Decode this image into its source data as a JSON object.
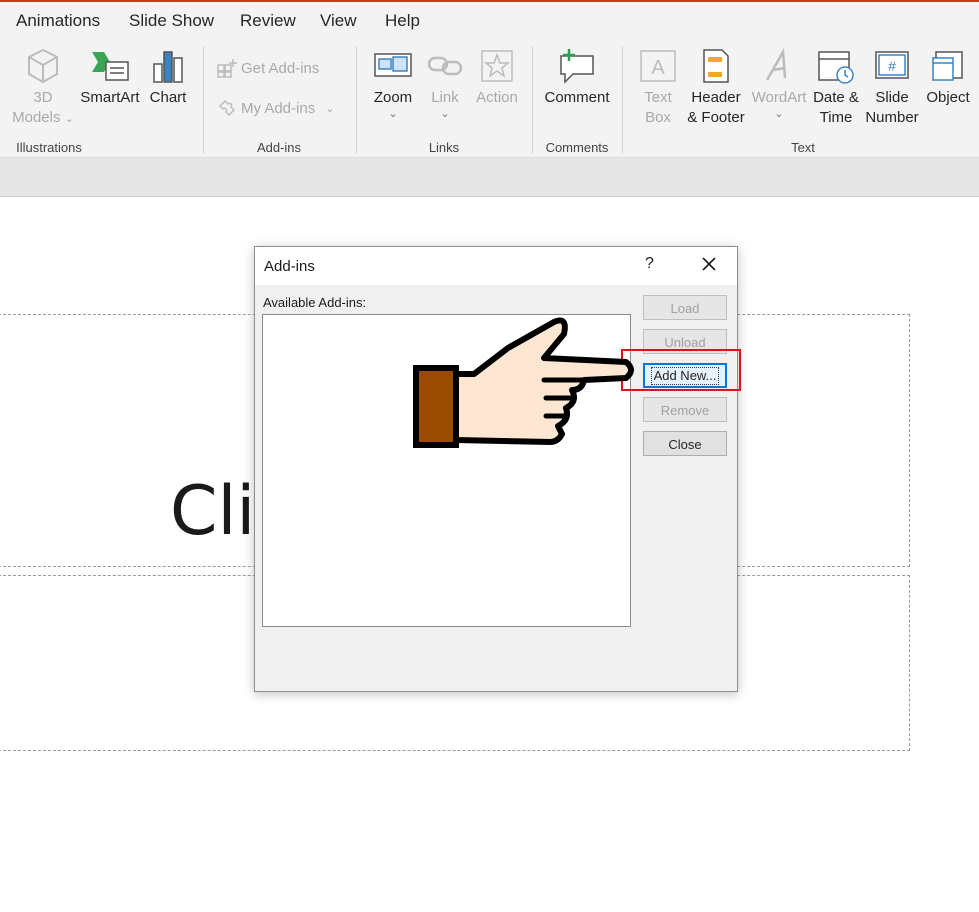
{
  "menu": {
    "tabs": [
      "Animations",
      "Slide Show",
      "Review",
      "View",
      "Help"
    ]
  },
  "ribbon": {
    "models": {
      "line1": "3D",
      "line2": "Models",
      "chev": "⌄"
    },
    "smartart": "SmartArt",
    "chart": "Chart",
    "get_addins": "Get Add-ins",
    "my_addins": "My Add-ins",
    "zoom": "Zoom",
    "link": "Link",
    "action": "Action",
    "comment": "Comment",
    "textbox": {
      "line1": "Text",
      "line2": "Box"
    },
    "header_footer": {
      "line1": "Header",
      "line2": "& Footer"
    },
    "wordart": "WordArt",
    "datetime": {
      "line1": "Date &",
      "line2": "Time"
    },
    "slide_number": {
      "line1": "Slide",
      "line2": "Number"
    },
    "object": "Object",
    "groups": {
      "illustrations": "Illustrations",
      "addins": "Add-ins",
      "links": "Links",
      "comments": "Comments",
      "text": "Text"
    }
  },
  "slide": {
    "title_text": "Clic"
  },
  "dialog": {
    "title": "Add-ins",
    "help": "?",
    "available_label": "Available Add-ins:",
    "buttons": {
      "load": "Load",
      "unload": "Unload",
      "add_new": "Add New...",
      "remove": "Remove",
      "close": "Close"
    }
  },
  "colors": {
    "accent": "#c43e1c",
    "highlight_box": "#e0101e",
    "hand_cuff": "#994c00",
    "hand_skin": "#fde7d3"
  }
}
